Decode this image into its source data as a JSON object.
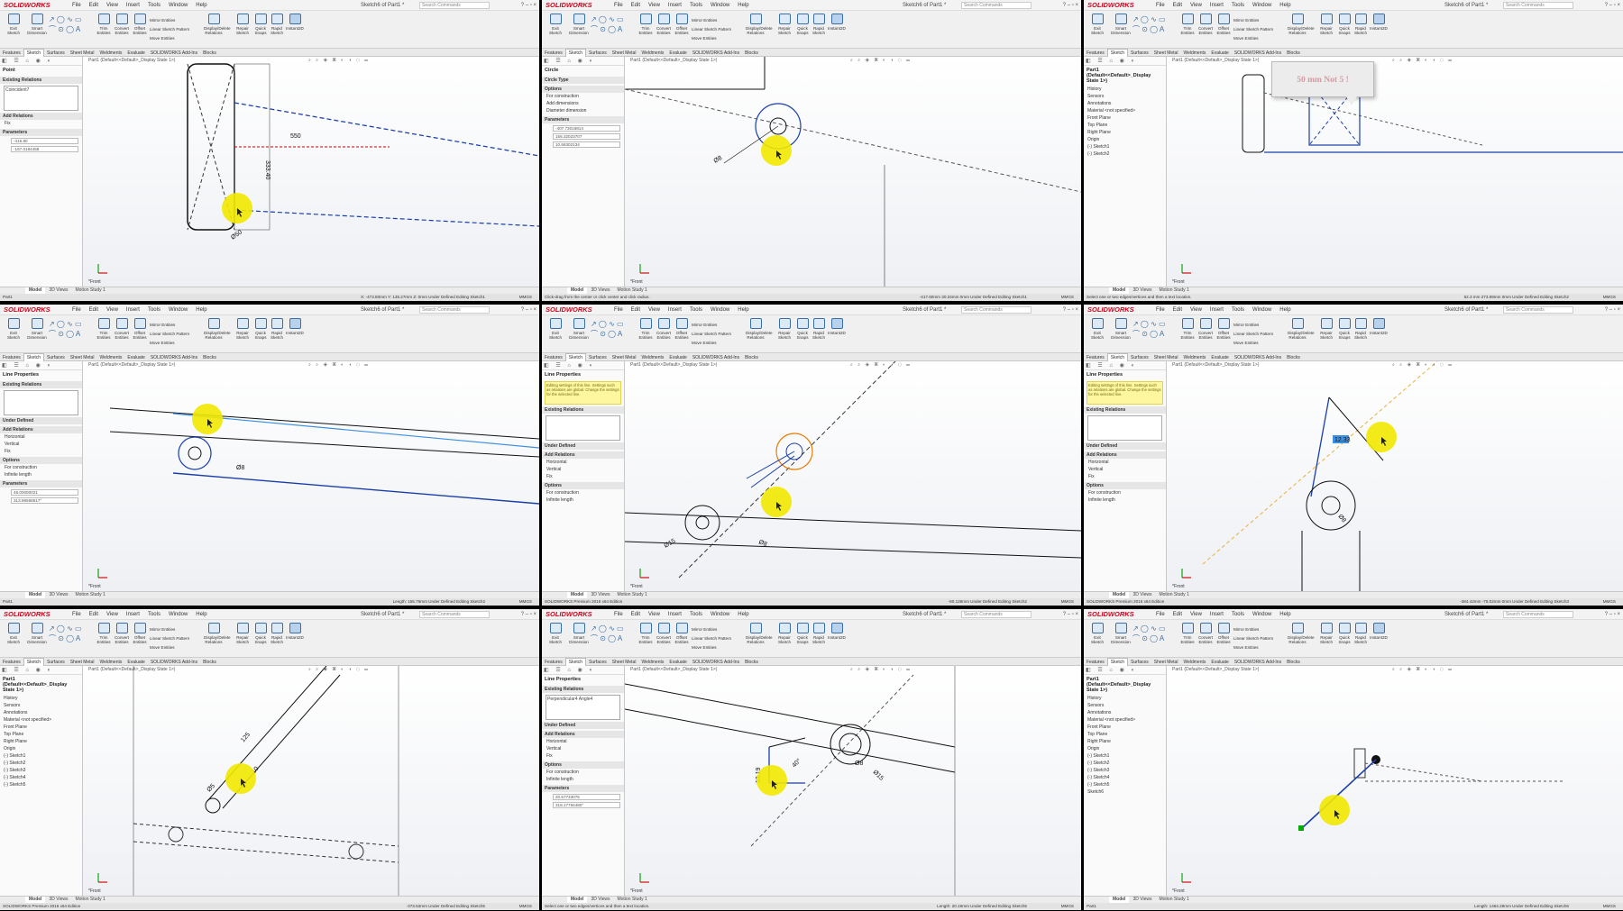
{
  "common": {
    "app_logo": "SOLIDWORKS",
    "menus": [
      "File",
      "Edit",
      "View",
      "Insert",
      "Tools",
      "Window",
      "Help"
    ],
    "doc_title": "Sketch6 of Part1 *",
    "search_placeholder": "Search Commands",
    "ribbon_buttons": [
      "Exit Sketch",
      "Smart Dimension",
      "Trim Entities",
      "Convert Entities",
      "Offset Entities",
      "Display/Delete Relations",
      "Repair Sketch",
      "Quick Snaps",
      "Rapid Sketch",
      "Instant2D"
    ],
    "ribbon_group": [
      "Mirror Entities",
      "Linear Sketch Pattern",
      "Move Entities"
    ],
    "command_tabs": [
      "Features",
      "Sketch",
      "Surfaces",
      "Sheet Metal",
      "Weldments",
      "Evaluate",
      "SOLIDWORKS Add-Ins",
      "Blocks"
    ],
    "model_tabs": [
      "Model",
      "3D Views",
      "Motion Study 1"
    ],
    "view_label": "*Front",
    "part_header": "Part1 (Default<<Default>_Display State 1>)",
    "units": "MMGS",
    "accent_blue": "#1a3ea8",
    "highlight_yellow": "#f2e800"
  },
  "panels": [
    {
      "pm_title": "Point",
      "sections": [
        {
          "header": "Existing Relations",
          "box": "Coincident7"
        },
        {
          "header": "Add Relations",
          "items": [
            "Fix"
          ]
        },
        {
          "header": "Parameters",
          "values": [
            "-416.80",
            "-167.0184458"
          ]
        }
      ],
      "dims": [
        "550",
        "333.40",
        "Ø50"
      ],
      "status_left": "Part1",
      "status_right": "X: -473.80mm  Y: 135.27mm  Z: 0mm   Under Defined   Editing Sketch1"
    },
    {
      "pm_title": "Circle",
      "sections": [
        {
          "header": "Circle Type",
          "items": []
        },
        {
          "header": "Options",
          "items": [
            "For construction",
            "Add dimensions",
            "Diameter dimension"
          ]
        },
        {
          "header": "Parameters",
          "values": [
            "-407.73016814",
            "156.32023707",
            "10.66302134"
          ]
        }
      ],
      "dims": [
        "Ø8"
      ],
      "status_left": "Click-drag from the center or click center and click radius.",
      "status_right": "-417.60mm   30.34mm   0mm   Under Defined   Editing Sketch1"
    },
    {
      "pm_title": "Part1 (Default<<Default>_Display State 1>)",
      "tree": [
        "History",
        "Sensors",
        "Annotations",
        "Material <not specified>",
        "Front Plane",
        "Top Plane",
        "Right Plane",
        "Origin",
        "(-) Sketch1",
        "(-) Sketch2"
      ],
      "dims": [],
      "callout": "50 mm Not 5 !",
      "status_left": "Select one or two edges/vertices and then a text location.",
      "status_right": "62.3 mm   273.89mm   0mm   Under Defined   Editing Sketch2"
    },
    {
      "pm_title": "Line Properties",
      "sections": [
        {
          "header": "Existing Relations",
          "box": ""
        },
        {
          "header": "Under Defined",
          "items": []
        },
        {
          "header": "Add Relations",
          "items": [
            "Horizontal",
            "Vertical",
            "Fix"
          ]
        },
        {
          "header": "Options",
          "items": [
            "For construction",
            "Infinite length"
          ]
        },
        {
          "header": "Parameters",
          "values": [
            "48.00000021",
            "313.86568617°"
          ]
        }
      ],
      "dims": [
        "Ø8"
      ],
      "status_left": "Part1",
      "status_right": "Length: 155.76mm   Under Defined   Editing Sketch2"
    },
    {
      "pm_title": "Line Properties",
      "message": "Editing settings of this line. Settings such as relations are global. Change the settings for the selected line.",
      "sections": [
        {
          "header": "Existing Relations",
          "box": ""
        },
        {
          "header": "Under Defined",
          "items": []
        },
        {
          "header": "Add Relations",
          "items": [
            "Horizontal",
            "Vertical",
            "Fix"
          ]
        },
        {
          "header": "Options",
          "items": [
            "For construction",
            "Infinite length"
          ]
        }
      ],
      "dims": [
        "Ø15",
        "Ø8",
        "Ø15",
        "Ø8"
      ],
      "status_left": "SOLIDWORKS Premium 2016 x64 Edition",
      "status_right": "-80.128mm   Under Defined   Editing Sketch2"
    },
    {
      "pm_title": "Line Properties",
      "message": "Editing settings of this line. Settings such as relations are global. Change the settings for the selected line.",
      "sections": [
        {
          "header": "Existing Relations",
          "box": ""
        },
        {
          "header": "Under Defined",
          "items": []
        },
        {
          "header": "Add Relations",
          "items": [
            "Horizontal",
            "Vertical",
            "Fix"
          ]
        },
        {
          "header": "Options",
          "items": [
            "For construction",
            "Infinite length"
          ]
        }
      ],
      "dims": [
        "Ø8",
        "12.33"
      ],
      "status_left": "SOLIDWORKS Premium 2016 x64 Edition",
      "status_right": "-384.42mm   -75.02mm   0mm   Under Defined   Editing Sketch3"
    },
    {
      "pm_title": "Part1 (Default<<Default>_Display State 1>)",
      "tree": [
        "History",
        "Sensors",
        "Annotations",
        "Material <not specified>",
        "Front Plane",
        "Top Plane",
        "Right Plane",
        "Origin",
        "(-) Sketch1",
        "(-) Sketch2",
        "(-) Sketch3",
        "(-) Sketch4",
        "(-) Sketch5"
      ],
      "dims": [
        "125",
        "10",
        "Ø5"
      ],
      "status_left": "SOLIDWORKS Premium 2016 x64 Edition",
      "status_right": "-373.53mm   Under Defined   Editing Sketch5"
    },
    {
      "pm_title": "Line Properties",
      "sections": [
        {
          "header": "Existing Relations",
          "box": "Perpendicular4\nAngle4"
        },
        {
          "header": "Under Defined",
          "items": []
        },
        {
          "header": "Add Relations",
          "items": [
            "Horizontal",
            "Vertical",
            "Fix"
          ]
        },
        {
          "header": "Options",
          "items": [
            "For construction",
            "Infinite length"
          ]
        },
        {
          "header": "Parameters",
          "values": [
            "20.57733075",
            "318.17784480°"
          ]
        }
      ],
      "dims": [
        "Ø8",
        "Ø15",
        "13.19",
        "40°"
      ],
      "status_left": "Select one or two edges/vertices and then a text location.",
      "status_right": "Length: 20.19mm   Under Defined   Editing Sketch5"
    },
    {
      "pm_title": "Part1 (Default<<Default>_Display State 1>)",
      "tree": [
        "History",
        "Sensors",
        "Annotations",
        "Material <not specified>",
        "Front Plane",
        "Top Plane",
        "Right Plane",
        "Origin",
        "(-) Sketch1",
        "(-) Sketch2",
        "(-) Sketch3",
        "(-) Sketch4",
        "(-) Sketch5",
        "Sketch6"
      ],
      "dims": [],
      "status_left": "Part1",
      "status_right": "Length: 1464.28mm   Under Defined   Editing Sketch6"
    }
  ]
}
